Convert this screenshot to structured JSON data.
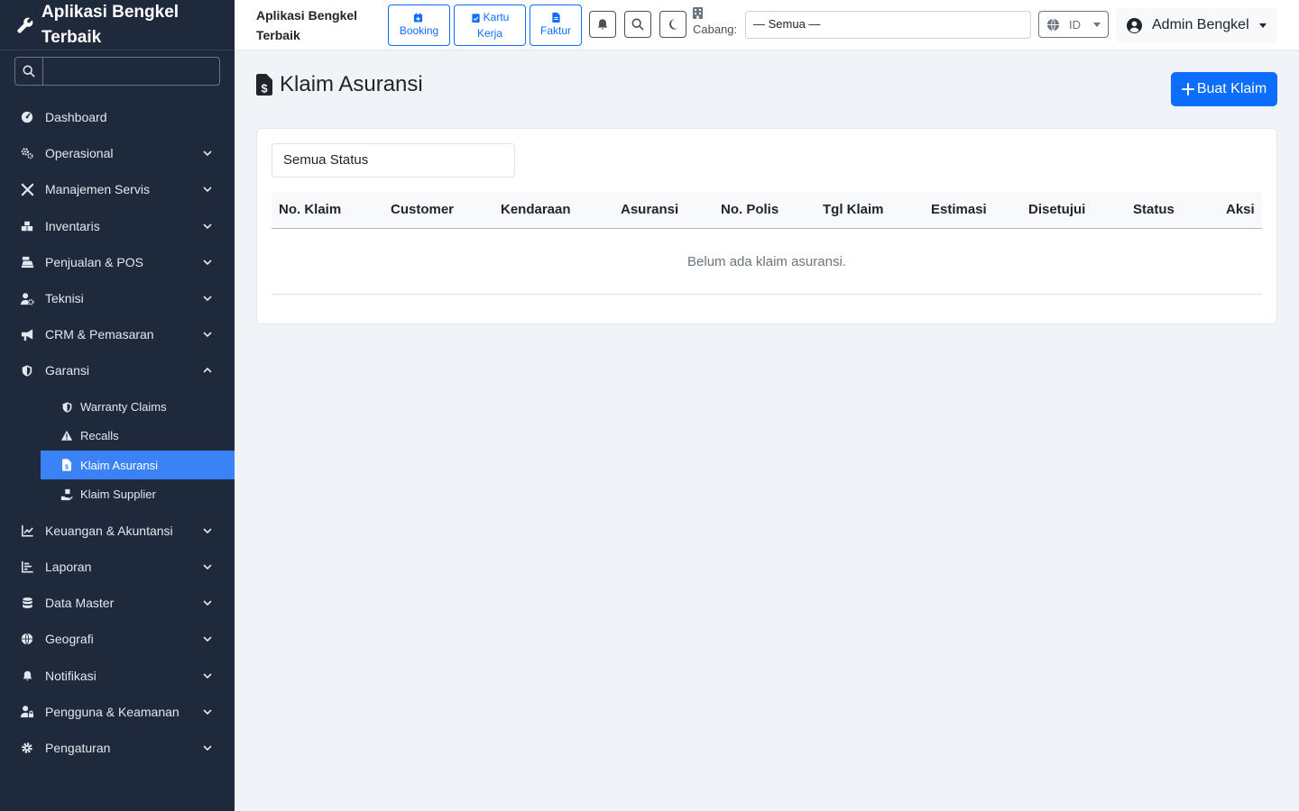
{
  "sidebar": {
    "brand": "Aplikasi Bengkel Terbaik",
    "search_placeholder": "",
    "items": [
      {
        "label": "Dashboard",
        "icon": "dashboard-icon",
        "expandable": false
      },
      {
        "label": "Operasional",
        "icon": "gears-icon",
        "expandable": true
      },
      {
        "label": "Manajemen Servis",
        "icon": "tools-icon",
        "expandable": true
      },
      {
        "label": "Inventaris",
        "icon": "boxes-icon",
        "expandable": true
      },
      {
        "label": "Penjualan & POS",
        "icon": "cash-register-icon",
        "expandable": true
      },
      {
        "label": "Teknisi",
        "icon": "user-gear-icon",
        "expandable": true
      },
      {
        "label": "CRM & Pemasaran",
        "icon": "bullhorn-icon",
        "expandable": true
      },
      {
        "label": "Garansi",
        "icon": "shield-icon",
        "expandable": true,
        "expanded": true
      },
      {
        "label": "Keuangan & Akuntansi",
        "icon": "chart-line-icon",
        "expandable": true
      },
      {
        "label": "Laporan",
        "icon": "chart-bar-icon",
        "expandable": true
      },
      {
        "label": "Data Master",
        "icon": "database-icon",
        "expandable": true
      },
      {
        "label": "Geografi",
        "icon": "globe-icon",
        "expandable": true
      },
      {
        "label": "Notifikasi",
        "icon": "bell-icon",
        "expandable": true
      },
      {
        "label": "Pengguna & Keamanan",
        "icon": "user-lock-icon",
        "expandable": true
      },
      {
        "label": "Pengaturan",
        "icon": "cog-icon",
        "expandable": true
      }
    ],
    "garansi_sub": [
      {
        "label": "Warranty Claims",
        "icon": "shield-icon"
      },
      {
        "label": "Recalls",
        "icon": "warning-icon"
      },
      {
        "label": "Klaim Asuransi",
        "icon": "file-invoice-dollar-icon",
        "active": true
      },
      {
        "label": "Klaim Supplier",
        "icon": "hand-holding-box-icon"
      }
    ]
  },
  "header": {
    "title": "Aplikasi Bengkel Terbaik",
    "quick": {
      "booking": "Booking",
      "kartu_kerja_1": "Kartu",
      "kartu_kerja_2": "Kerja",
      "faktur": "Faktur"
    },
    "cabang_label": "Cabang:",
    "cabang_value": "— Semua —",
    "lang": "ID",
    "user": "Admin Bengkel"
  },
  "main": {
    "page_title": "Klaim Asuransi",
    "create_button": "Buat Klaim",
    "status_filter": "Semua Status",
    "columns": [
      "No. Klaim",
      "Customer",
      "Kendaraan",
      "Asuransi",
      "No. Polis",
      "Tgl Klaim",
      "Estimasi",
      "Disetujui",
      "Status",
      "Aksi"
    ],
    "empty_text": "Belum ada klaim asuransi."
  },
  "colors": {
    "sidebar_bg": "#1e293b",
    "accent": "#0d6efd",
    "active_item": "#3b82f6",
    "page_bg": "#f0f4f8"
  }
}
